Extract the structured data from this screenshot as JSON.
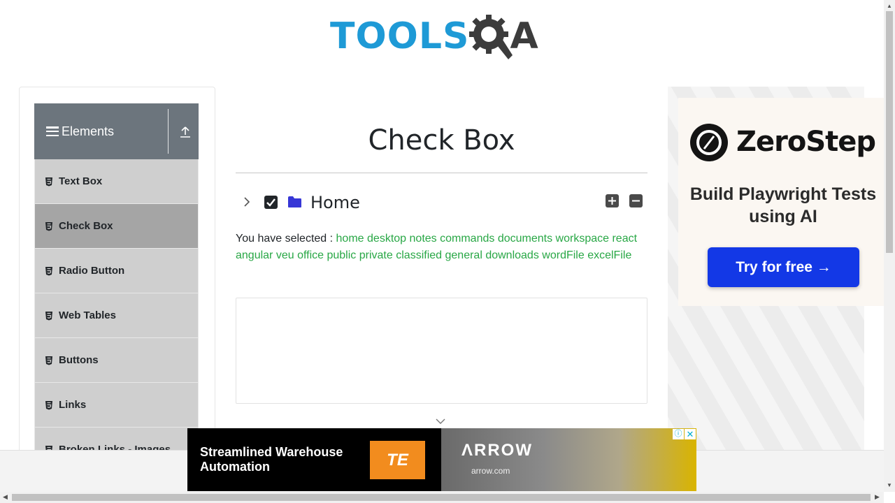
{
  "header": {
    "logo_text": "TOOLS",
    "logo_suffix": "A"
  },
  "sidebar": {
    "group_title": "Elements",
    "items": [
      {
        "label": "Text Box",
        "active": false
      },
      {
        "label": "Check Box",
        "active": true
      },
      {
        "label": "Radio Button",
        "active": false
      },
      {
        "label": "Web Tables",
        "active": false
      },
      {
        "label": "Buttons",
        "active": false
      },
      {
        "label": "Links",
        "active": false
      },
      {
        "label": "Broken Links - Images",
        "active": false
      }
    ]
  },
  "main": {
    "title": "Check Box",
    "tree": {
      "root_label": "Home",
      "root_checked": true
    },
    "result_prefix": "You have selected :",
    "selected": [
      "home",
      "desktop",
      "notes",
      "commands",
      "documents",
      "workspace",
      "react",
      "angular",
      "veu",
      "office",
      "public",
      "private",
      "classified",
      "general",
      "downloads",
      "wordFile",
      "excelFile"
    ]
  },
  "ad_right": {
    "brand": "ZeroStep",
    "tagline": "Build Playwright Tests using AI",
    "cta": "Try for free →"
  },
  "ad_bottom": {
    "headline": "Streamlined Warehouse Automation",
    "te_logo": "TE",
    "arrow_logo": "ΛRROW",
    "arrow_url": "arrow.com",
    "info": "ⓘ",
    "close": "✕"
  },
  "colors": {
    "accent_blue": "#1e9ad6",
    "selected_green": "#28a745",
    "header_gray": "#6c757d",
    "cta_blue": "#1338e6"
  }
}
